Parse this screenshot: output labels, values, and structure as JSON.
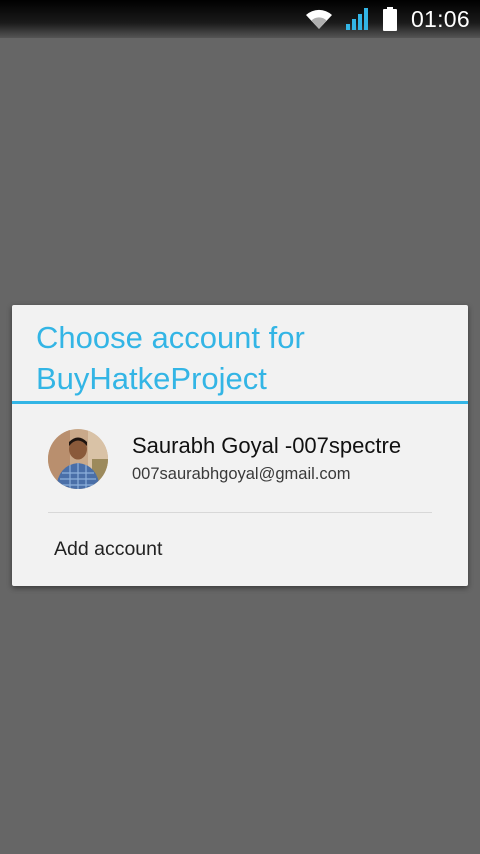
{
  "status_bar": {
    "time": "01:06",
    "icons": [
      "wifi-icon",
      "cell-signal-icon",
      "battery-icon"
    ]
  },
  "dialog": {
    "title": "Choose account for BuyHatkeProject",
    "accounts": [
      {
        "name": "Saurabh Goyal -007spectre",
        "email": "007saurabhgoyal@gmail.com",
        "avatar": "profile-photo"
      }
    ],
    "add_account_label": "Add account"
  },
  "colors": {
    "accent": "#33b5e5",
    "scrim": "#666666",
    "dialog_background": "#f2f2f2"
  }
}
